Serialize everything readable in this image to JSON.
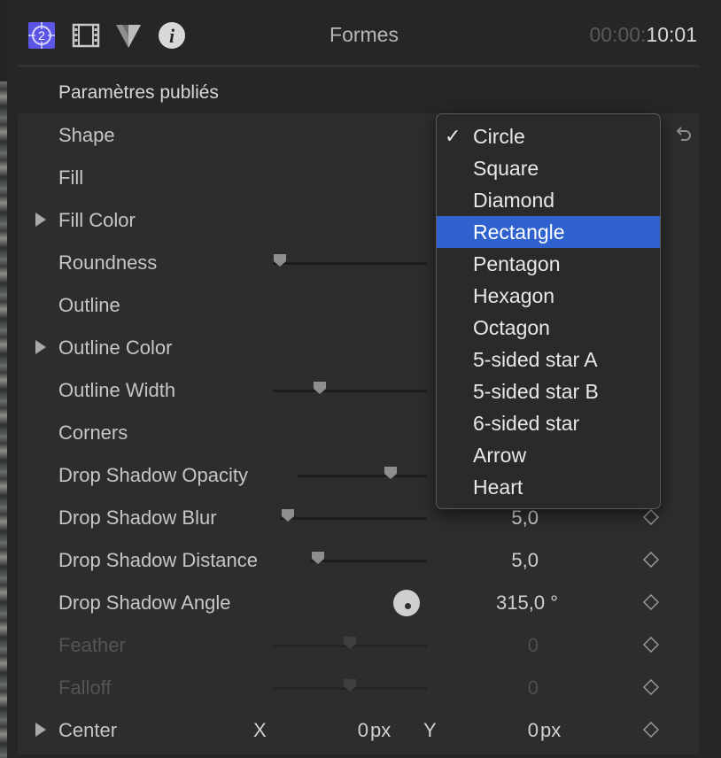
{
  "header": {
    "title": "Formes",
    "timecode_dim": "00:00:",
    "timecode_bright": "10:01",
    "tabs": [
      {
        "icon": "generator-icon",
        "badge": "2"
      },
      {
        "icon": "film-icon"
      },
      {
        "icon": "color-icon"
      },
      {
        "icon": "info-icon",
        "glyph": "i"
      }
    ]
  },
  "section": {
    "title": "Paramètres publiés"
  },
  "params": [
    {
      "label": "Shape"
    },
    {
      "label": "Fill"
    },
    {
      "label": "Fill Color"
    },
    {
      "label": "Roundness",
      "slider": 0.0
    },
    {
      "label": "Outline"
    },
    {
      "label": "Outline Color"
    },
    {
      "label": "Outline Width",
      "slider": 0.3
    },
    {
      "label": "Corners"
    },
    {
      "label": "Drop Shadow Opacity",
      "slider": 0.75
    },
    {
      "label": "Drop Shadow Blur",
      "slider": 0.05,
      "value": "5,0"
    },
    {
      "label": "Drop Shadow Distance",
      "slider": 0.05,
      "value": "5,0"
    },
    {
      "label": "Drop Shadow Angle",
      "value": "315,0 °"
    },
    {
      "label": "Feather",
      "slider": 0.5,
      "value": "0"
    },
    {
      "label": "Falloff",
      "slider": 0.5,
      "value": "0"
    },
    {
      "label": "Center",
      "x_label": "X",
      "x_value": "0",
      "x_unit": "px",
      "y_label": "Y",
      "y_value": "0",
      "y_unit": "px"
    }
  ],
  "shape_menu": {
    "selected": "Circle",
    "highlighted": "Rectangle",
    "check_glyph": "✓",
    "options": [
      "Circle",
      "Square",
      "Diamond",
      "Rectangle",
      "Pentagon",
      "Hexagon",
      "Octagon",
      "5-sided star A",
      "5-sided star B",
      "6-sided star",
      "Arrow",
      "Heart"
    ]
  },
  "colors": {
    "highlight": "#2f62cf",
    "badge_purple": "#5b55e6"
  }
}
